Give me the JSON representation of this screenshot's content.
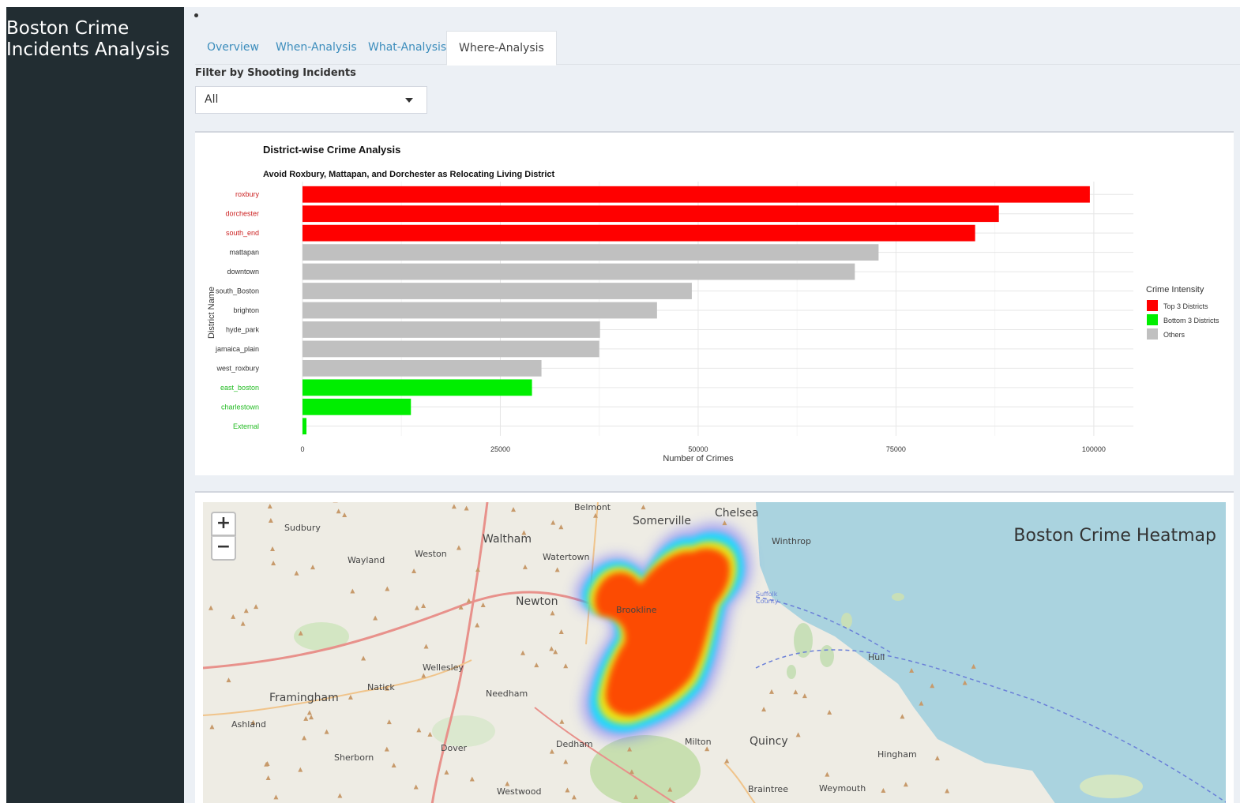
{
  "app": {
    "title_line1": "Boston Crime",
    "title_line2": "Incidents Analysis"
  },
  "tabs": [
    {
      "label": "Overview",
      "active": false
    },
    {
      "label": "When-Analysis",
      "active": false
    },
    {
      "label": "What-Analysis",
      "active": false
    },
    {
      "label": "Where-Analysis",
      "active": true
    }
  ],
  "filter": {
    "label": "Filter by Shooting Incidents",
    "value": "All"
  },
  "colors": {
    "top": "#ff0000",
    "bottom": "#00ee00",
    "others": "#c0c0c0",
    "sidebar": "#222d32",
    "tab_link": "#3c8dbc"
  },
  "chart_data": {
    "type": "bar",
    "orientation": "horizontal",
    "title": "District-wise Crime Analysis",
    "subtitle": "Avoid Roxbury, Mattapan, and Dorchester as Relocating Living District",
    "xlabel": "Number of Crimes",
    "ylabel": "District Name",
    "xlim": [
      0,
      105000
    ],
    "xticks": [
      0,
      25000,
      50000,
      75000,
      100000
    ],
    "grid": true,
    "legend": {
      "title": "Crime Intensity",
      "position": "right",
      "entries": [
        {
          "label": "Top 3 Districts",
          "color": "#ff0000"
        },
        {
          "label": "Bottom 3 Districts",
          "color": "#00ee00"
        },
        {
          "label": "Others",
          "color": "#c0c0c0"
        }
      ]
    },
    "categories": [
      "roxbury",
      "dorchester",
      "south_end",
      "mattapan",
      "downtown",
      "south_Boston",
      "brighton",
      "hyde_park",
      "jamaica_plain",
      "west_roxbury",
      "east_boston",
      "charlestown",
      "External"
    ],
    "values": [
      99500,
      88000,
      85000,
      72800,
      69800,
      49200,
      44800,
      37600,
      37500,
      30200,
      29000,
      13700,
      500
    ],
    "groups": [
      "top",
      "top",
      "top",
      "others",
      "others",
      "others",
      "others",
      "others",
      "others",
      "others",
      "bottom",
      "bottom",
      "bottom"
    ]
  },
  "map": {
    "title": "Boston Crime Heatmap",
    "zoom_in": "+",
    "zoom_out": "−",
    "places": [
      {
        "name": "Sudbury",
        "size": "small"
      },
      {
        "name": "Wayland",
        "size": "small"
      },
      {
        "name": "Weston",
        "size": "small"
      },
      {
        "name": "Waltham",
        "size": "large"
      },
      {
        "name": "Belmont",
        "size": "small"
      },
      {
        "name": "Somerville",
        "size": "large"
      },
      {
        "name": "Chelsea",
        "size": "large"
      },
      {
        "name": "Winthrop",
        "size": "small"
      },
      {
        "name": "Watertown",
        "size": "small"
      },
      {
        "name": "Newton",
        "size": "large"
      },
      {
        "name": "Brookline",
        "size": "small"
      },
      {
        "name": "Wellesley",
        "size": "small"
      },
      {
        "name": "Natick",
        "size": "small"
      },
      {
        "name": "Framingham",
        "size": "large"
      },
      {
        "name": "Needham",
        "size": "small"
      },
      {
        "name": "Ashland",
        "size": "small"
      },
      {
        "name": "Sherborn",
        "size": "small"
      },
      {
        "name": "Dover",
        "size": "small"
      },
      {
        "name": "Dedham",
        "size": "small"
      },
      {
        "name": "Milton",
        "size": "small"
      },
      {
        "name": "Quincy",
        "size": "large"
      },
      {
        "name": "Hull",
        "size": "small"
      },
      {
        "name": "Hingham",
        "size": "small"
      },
      {
        "name": "Braintree",
        "size": "small"
      },
      {
        "name": "Weymouth",
        "size": "small"
      },
      {
        "name": "Westwood",
        "size": "small"
      },
      {
        "name": "Suffolk County",
        "size": "tiny"
      }
    ]
  }
}
